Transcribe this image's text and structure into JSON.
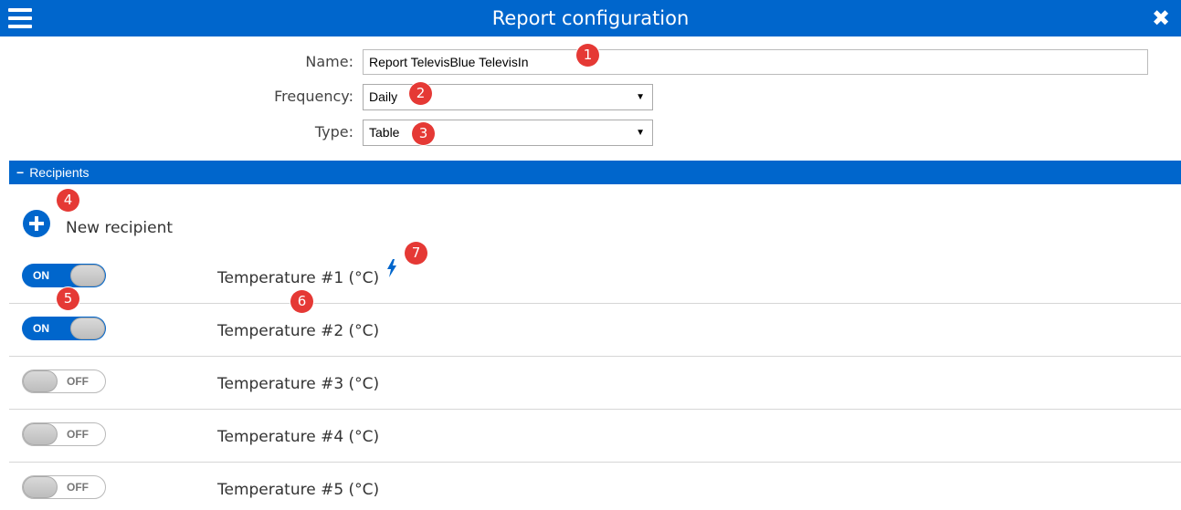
{
  "header": {
    "title": "Report configuration",
    "menu_icon": "hamburger-menu-icon",
    "close_icon": "close-icon",
    "background": "#0066cc"
  },
  "form": {
    "name": {
      "label": "Name:",
      "value": "Report TelevisBlue TelevisIn",
      "badge": "1"
    },
    "frequency": {
      "label": "Frequency:",
      "selected": "Daily",
      "badge": "2"
    },
    "type": {
      "label": "Type:",
      "selected": "Table",
      "badge": "3"
    }
  },
  "recipients": {
    "section_title": "Recipients",
    "collapse_symbol": "−",
    "new_recipient_label": "New recipient",
    "new_recipient_badge": "4",
    "toggle_badge": "5",
    "label_badge": "6",
    "alert_badge": "7",
    "items": [
      {
        "label": "Temperature #1 (°C)",
        "toggle": "ON",
        "alert_icon": "lightning-bolt-icon"
      },
      {
        "label": "Temperature #2 (°C)",
        "toggle": "ON"
      },
      {
        "label": "Temperature #3 (°C)",
        "toggle": "OFF"
      },
      {
        "label": "Temperature #4 (°C)",
        "toggle": "OFF"
      },
      {
        "label": "Temperature #5 (°C)",
        "toggle": "OFF"
      }
    ]
  },
  "colors": {
    "accent": "#0066cc",
    "badge": "#e53935"
  }
}
